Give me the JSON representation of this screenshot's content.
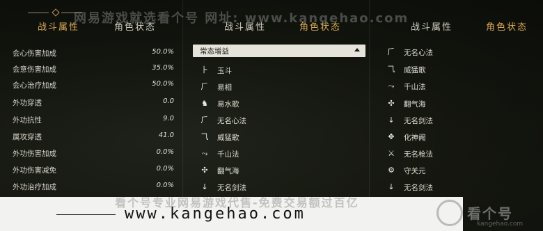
{
  "watermark_top": "网易游戏就选看个号  网址: www.kangehao.com",
  "panel1": {
    "tabs": [
      "战斗属性",
      "角色状态"
    ],
    "stats": [
      {
        "label": "会心伤害加成",
        "value": "50.0%"
      },
      {
        "label": "会意伤害加成",
        "value": "35.0%"
      },
      {
        "label": "会心治疗加成",
        "value": "50.0%"
      },
      {
        "label": "外功穿透",
        "value": "0.0"
      },
      {
        "label": "外功抗性",
        "value": "9.0"
      },
      {
        "label": "属攻穿透",
        "value": "41.0"
      },
      {
        "label": "外功伤害加成",
        "value": "0.0%"
      },
      {
        "label": "外功伤害减免",
        "value": "0.0%"
      },
      {
        "label": "外功治疗加成",
        "value": "0.0%"
      }
    ]
  },
  "panel2": {
    "tabs": [
      "战斗属性",
      "角色状态"
    ],
    "dropdown_label": "常态增益",
    "skills": [
      {
        "icon": "⺊",
        "name": "玉斗"
      },
      {
        "icon": "⺁",
        "name": "易相"
      },
      {
        "icon": "♞",
        "name": "易水歌"
      },
      {
        "icon": "⺁",
        "name": "无名心法"
      },
      {
        "icon": "⺄",
        "name": "威猛歌"
      },
      {
        "icon": "⤳",
        "name": "千山法"
      },
      {
        "icon": "✣",
        "name": "翻气海"
      },
      {
        "icon": "↓",
        "name": "无名剑法"
      }
    ]
  },
  "panel3": {
    "tabs": [
      "战斗属性",
      "角色状态"
    ],
    "skills": [
      {
        "icon": "⺁",
        "name": "无名心法"
      },
      {
        "icon": "⺄",
        "name": "威猛歌"
      },
      {
        "icon": "⤳",
        "name": "千山法"
      },
      {
        "icon": "✣",
        "name": "翻气海"
      },
      {
        "icon": "↓",
        "name": "无名剑法"
      },
      {
        "icon": "✥",
        "name": "化神阙"
      },
      {
        "icon": "⚔",
        "name": "无名枪法"
      },
      {
        "icon": "⚙",
        "name": "守关元"
      },
      {
        "icon": "↓",
        "name": "无名剑法"
      }
    ]
  },
  "banner": {
    "url": "www.kangehao.com",
    "ghost": "看个号专业网易游戏代售-免费交易额过百亿"
  },
  "logo": {
    "text": "看个号",
    "sub": "kangehao.com"
  }
}
